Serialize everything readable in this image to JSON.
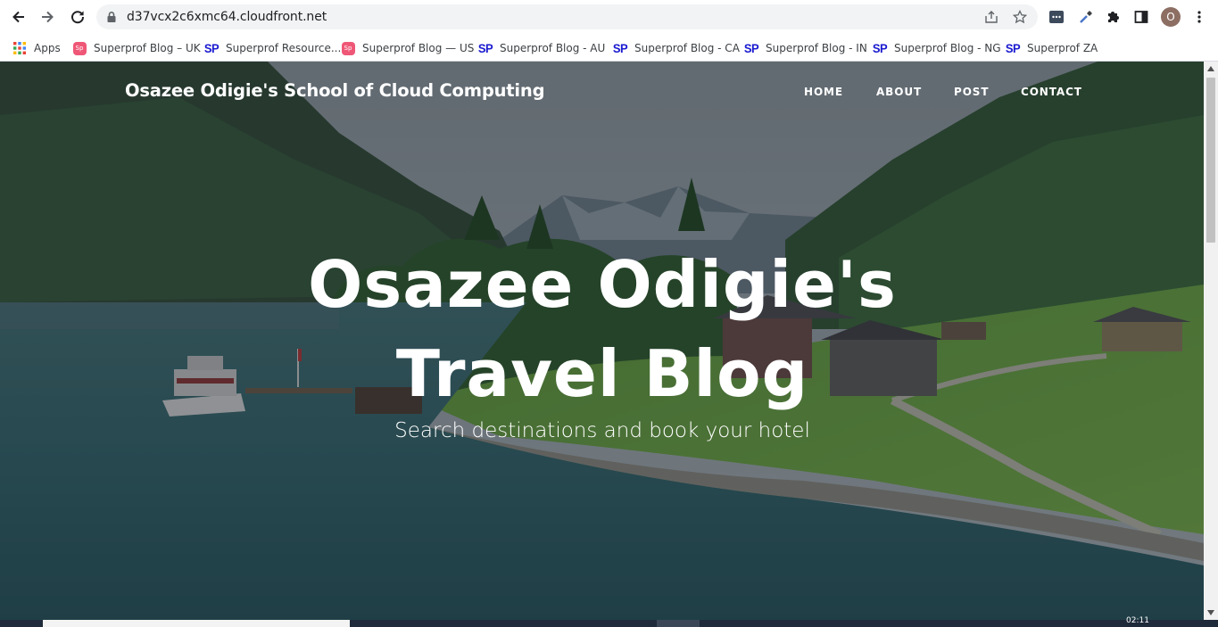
{
  "browser": {
    "url": "d37vcx2c6xmc64.cloudfront.net",
    "profile_initial": "O",
    "icons": {
      "back": "arrow-left-icon",
      "forward": "arrow-right-icon",
      "reload": "reload-icon",
      "lock": "lock-icon",
      "share": "share-icon",
      "bookmark": "star-icon",
      "extensions": [
        "cast-icon",
        "eyedropper-icon",
        "puzzle-icon",
        "sidepanel-icon"
      ],
      "menu": "kebab-menu-icon"
    }
  },
  "bookmarks": [
    {
      "label": "Apps",
      "favicon": "apps-grid"
    },
    {
      "label": "Superprof Blog – UK",
      "favicon": "superprof-pink"
    },
    {
      "label": "Superprof Resource...",
      "favicon": "sp"
    },
    {
      "label": "Superprof Blog — US",
      "favicon": "superprof-pink"
    },
    {
      "label": "Superprof Blog - AU",
      "favicon": "sp"
    },
    {
      "label": "Superprof Blog - CA",
      "favicon": "sp"
    },
    {
      "label": "Superprof Blog - IN",
      "favicon": "sp"
    },
    {
      "label": "Superprof Blog - NG",
      "favicon": "sp"
    },
    {
      "label": "Superprof ZA",
      "favicon": "sp"
    }
  ],
  "favicon_text": {
    "sp": "SP",
    "pink": "Sp"
  },
  "site": {
    "brand": "Osazee Odigie's School of Cloud Computing",
    "nav": [
      "HOME",
      "ABOUT",
      "POST",
      "CONTACT"
    ],
    "hero_title_line1": "Osazee Odigie's",
    "hero_title_line2": "Travel Blog",
    "hero_subtitle": "Search destinations and book your hotel"
  },
  "taskbar": {
    "clock": "02:11"
  },
  "colors": {
    "sp_blue": "#1a1ad0",
    "superprof_pink": "#ef5777",
    "overlay": "rgba(25,32,40,0.38)",
    "text_white": "#ffffff"
  }
}
